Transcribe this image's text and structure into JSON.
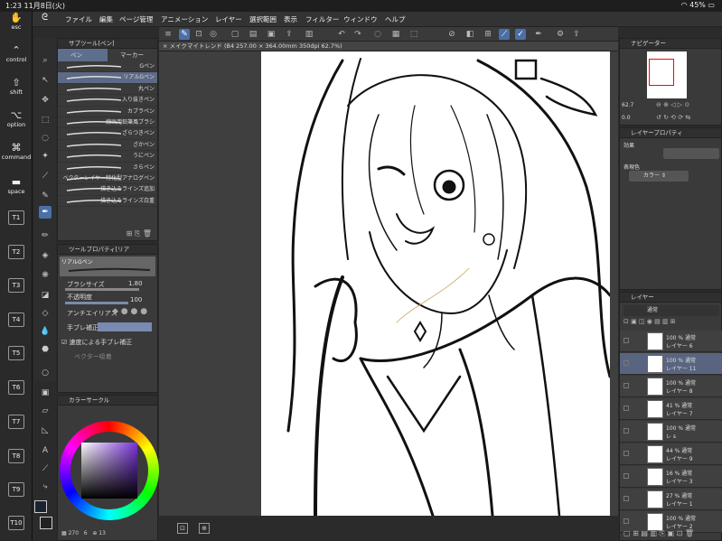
{
  "status": {
    "time": "1:23",
    "date": "11月8日(火)",
    "battery": "45%"
  },
  "shortcuts": [
    {
      "label": "esc",
      "icon": "hand-icon"
    },
    {
      "label": "control",
      "icon": "caret-up-icon"
    },
    {
      "label": "shift",
      "icon": "shift-icon"
    },
    {
      "label": "option",
      "icon": "option-icon"
    },
    {
      "label": "command",
      "icon": "command-icon"
    },
    {
      "label": "space",
      "icon": "space-icon"
    }
  ],
  "t_keys": [
    "T1",
    "T2",
    "T3",
    "T4",
    "T5",
    "T6",
    "T7",
    "T8",
    "T9",
    "T10"
  ],
  "menu": [
    "ファイル",
    "編集",
    "ページ管理",
    "アニメーション",
    "レイヤー",
    "選択範囲",
    "表示",
    "フィルター",
    "ウィンドウ",
    "ヘルプ"
  ],
  "doc_tab": "メイクマイトレンド (B4 257.00 × 364.00mm 350dpi 62.7%)",
  "subtool": {
    "title": "サブツール[ペン]",
    "tabs": [
      "ペン",
      "マーカー"
    ],
    "brushes": [
      "Gペン",
      "リアルGペン",
      "丸ペン",
      "入り抜きペン",
      "カブラペン",
      "線画用鉛筆風ブラシ",
      "ざらつきペン",
      "ざかペン",
      "うにペン",
      "さらペン",
      "ベクターレイヤー特化型アナログペン",
      "描き込みラインズ追加",
      "描き込みラインズ白重"
    ]
  },
  "toolprop": {
    "title": "ツールプロパティ[リア",
    "brush_name": "リアルGペン",
    "brush_size_label": "ブラシサイズ",
    "brush_size_value": "1.80",
    "opacity_label": "不透明度",
    "opacity_value": "100",
    "antialias_label": "アンチエイリアス",
    "stabilize_label": "手ブレ補正",
    "speed_label": "速度による手ブレ補正",
    "vector_label": "ベクター吸着"
  },
  "colorwheel": {
    "title": "カラーサークル",
    "footer": "270",
    "footer2": "6",
    "footer3": "13"
  },
  "navigator": {
    "title": "ナビゲーター",
    "zoom": "62.7",
    "angle": "0.0"
  },
  "layerprop": {
    "title": "レイヤープロパティ",
    "effect_label": "効果",
    "express_label": "表現色",
    "express_value": "カラー"
  },
  "layers": {
    "title": "レイヤー",
    "blend": "通常",
    "rows": [
      {
        "pct": "100 % 通常",
        "name": "レイヤー 6"
      },
      {
        "pct": "100 % 通常",
        "name": "レイヤー 11"
      },
      {
        "pct": "100 % 通常",
        "name": "レイヤー 8"
      },
      {
        "pct": "41 % 通常",
        "name": "レイヤー 7"
      },
      {
        "pct": "100 % 通常",
        "name": "レ s"
      },
      {
        "pct": "44 % 通常",
        "name": "レイヤー 9"
      },
      {
        "pct": "16 % 通常",
        "name": "レイヤー 3"
      },
      {
        "pct": "27 % 通常",
        "name": "レイヤー 1"
      },
      {
        "pct": "100 % 通常",
        "name": "レイヤー 2"
      }
    ]
  }
}
